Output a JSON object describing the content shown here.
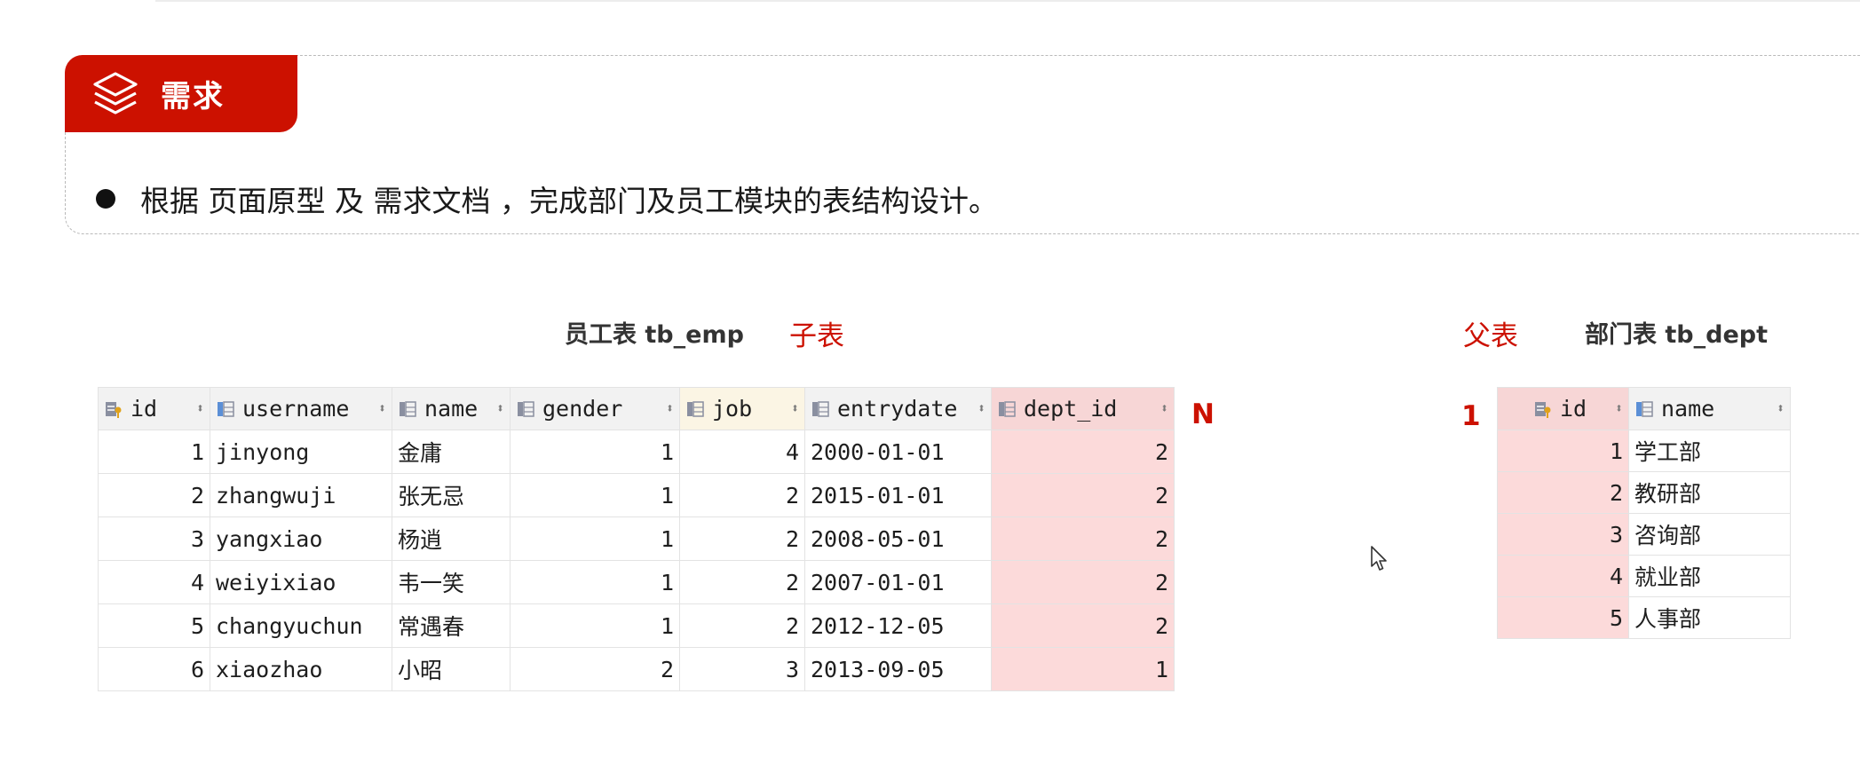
{
  "requirement": {
    "tag_label": "需求",
    "tag_icon": "layers-icon",
    "bullet_text": "根据 页面原型 及 需求文档 ，完成部门及员工模块的表结构设计。"
  },
  "emp_table": {
    "caption": "员工表 tb_emp",
    "role_label": "子表",
    "cardinality": "N",
    "columns": [
      "id",
      "username",
      "name",
      "gender",
      "job",
      "entrydate",
      "dept_id"
    ],
    "rows": [
      [
        "1",
        "jinyong",
        "金庸",
        "1",
        "4",
        "2000-01-01",
        "2"
      ],
      [
        "2",
        "zhangwuji",
        "张无忌",
        "1",
        "2",
        "2015-01-01",
        "2"
      ],
      [
        "3",
        "yangxiao",
        "杨逍",
        "1",
        "2",
        "2008-05-01",
        "2"
      ],
      [
        "4",
        "weiyixiao",
        "韦一笑",
        "1",
        "2",
        "2007-01-01",
        "2"
      ],
      [
        "5",
        "changyuchun",
        "常遇春",
        "1",
        "2",
        "2012-12-05",
        "2"
      ],
      [
        "6",
        "xiaozhao",
        "小昭",
        "2",
        "3",
        "2013-09-05",
        "1"
      ]
    ]
  },
  "dept_table": {
    "caption": "部门表 tb_dept",
    "role_label": "父表",
    "cardinality": "1",
    "columns": [
      "id",
      "name"
    ],
    "rows": [
      [
        "1",
        "学工部"
      ],
      [
        "2",
        "教研部"
      ],
      [
        "3",
        "咨询部"
      ],
      [
        "4",
        "就业部"
      ],
      [
        "5",
        "人事部"
      ]
    ]
  },
  "colors": {
    "accent_red": "#cc1100",
    "highlight_pink": "#fcdada",
    "header_gray": "#f2f2f2"
  },
  "icons": {
    "primary_key_column": "key-column-icon",
    "column": "column-icon",
    "sort": "sort-arrows-icon",
    "cursor": "mouse-cursor-icon"
  }
}
